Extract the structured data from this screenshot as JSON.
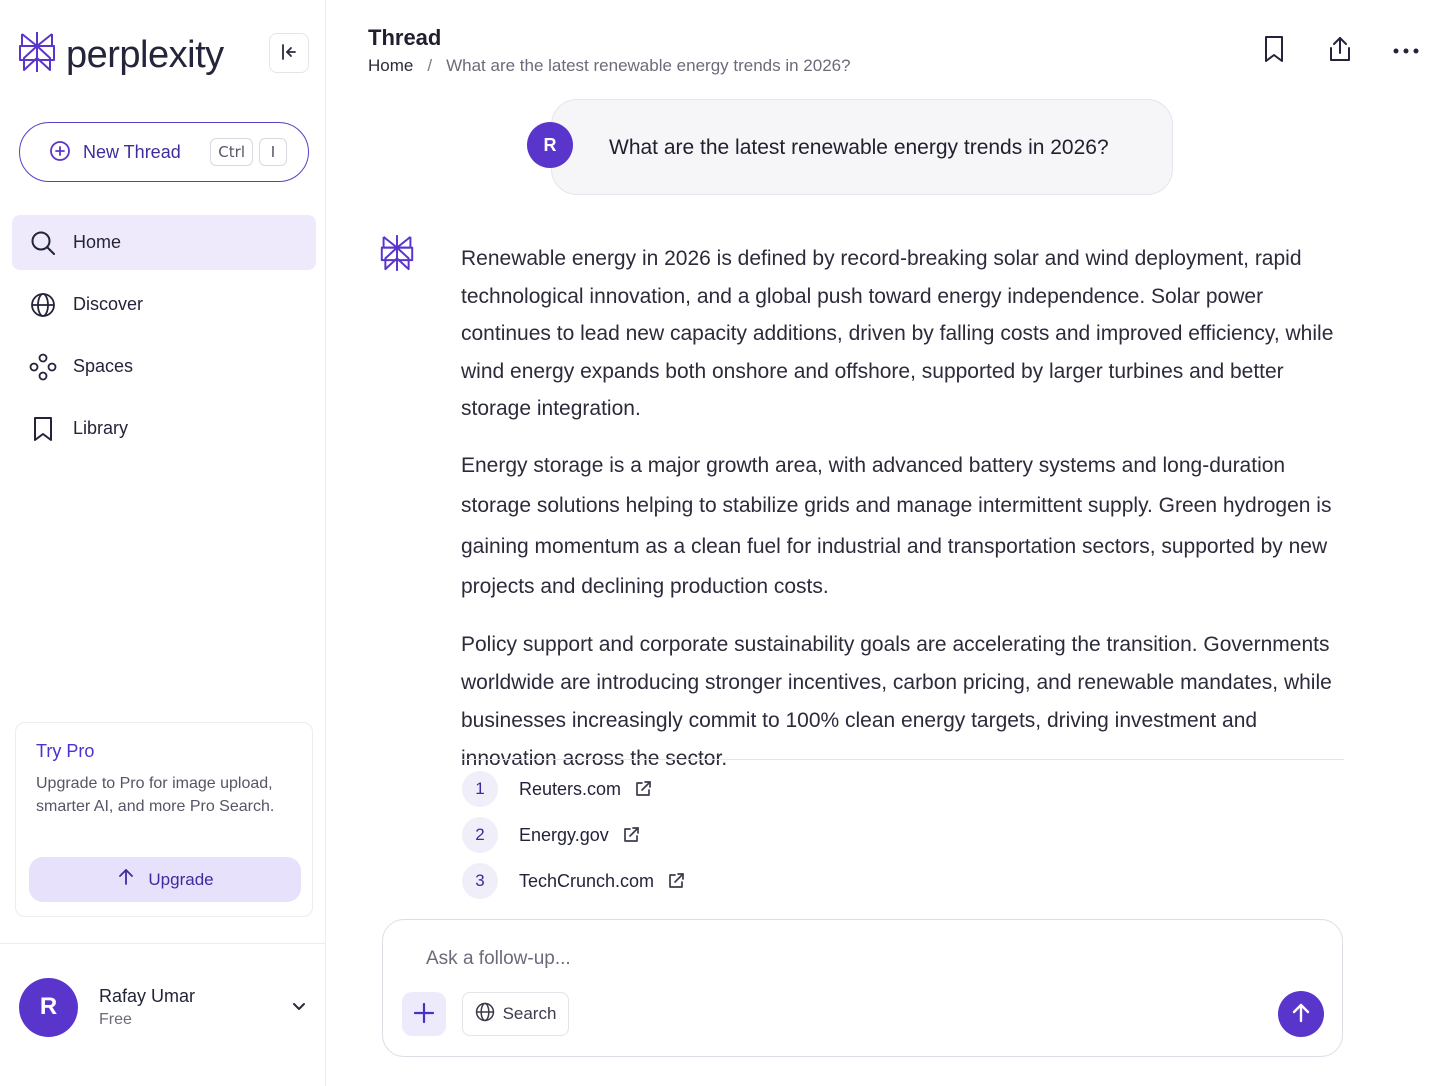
{
  "brand": {
    "name": "perplexity",
    "accent": "#5a35cc"
  },
  "sidebar": {
    "collapse_icon": "collapse-left-icon",
    "new_thread": {
      "label": "New Thread",
      "shortcut_keys": [
        "Ctrl",
        "I"
      ]
    },
    "nav": [
      {
        "label": "Home",
        "icon": "search-icon",
        "active": true
      },
      {
        "label": "Discover",
        "icon": "globe-icon",
        "active": false
      },
      {
        "label": "Spaces",
        "icon": "spaces-icon",
        "active": false
      },
      {
        "label": "Library",
        "icon": "bookmark-icon",
        "active": false
      }
    ],
    "pro": {
      "title": "Try Pro",
      "description": "Upgrade to Pro for image upload, smarter AI, and more Pro Search.",
      "button": "Upgrade"
    },
    "user": {
      "initial": "R",
      "name": "Rafay Umar",
      "plan": "Free"
    }
  },
  "header": {
    "title": "Thread",
    "breadcrumb": {
      "home": "Home",
      "separator": "/",
      "current": "What are the latest renewable energy trends in 2026?"
    },
    "actions": [
      "bookmark-icon",
      "share-icon",
      "more-icon"
    ]
  },
  "thread": {
    "question": {
      "avatar": "R",
      "text": "What are the latest renewable energy trends in 2026?"
    },
    "answer": [
      "Renewable energy in 2026 is defined by record-breaking solar and wind deployment, rapid technological innovation, and a global push toward energy independence. Solar power continues to lead new capacity additions, driven by falling costs and improved efficiency, while wind energy expands both onshore and offshore, supported by larger turbines and better storage integration.",
      "Energy storage is a major growth area, with advanced battery systems and long-duration storage solutions helping to stabilize grids and manage intermittent supply. Green hydrogen is gaining momentum as a clean fuel for industrial and transportation sectors, supported by new projects and declining production costs.",
      "Policy support and corporate sustainability goals are accelerating the transition. Governments worldwide are introducing stronger incentives, carbon pricing, and renewable mandates, while businesses increasingly commit to 100% clean energy targets, driving investment and innovation across the sector."
    ],
    "sources": [
      {
        "num": "1",
        "name": "Reuters.com"
      },
      {
        "num": "2",
        "name": "Energy.gov"
      },
      {
        "num": "3",
        "name": "TechCrunch.com"
      }
    ]
  },
  "composer": {
    "placeholder": "Ask a follow-up...",
    "search_label": "Search"
  }
}
